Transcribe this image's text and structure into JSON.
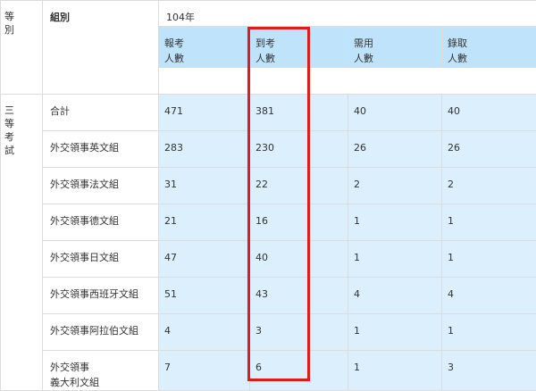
{
  "header": {
    "exam_class": "等別",
    "group": "組別",
    "year": "104年",
    "columns": [
      {
        "line1": "報考",
        "line2": "人數"
      },
      {
        "line1": "到考",
        "line2": "人數"
      },
      {
        "line1": "需用",
        "line2": "人數"
      },
      {
        "line1": "錄取",
        "line2": "人數"
      }
    ]
  },
  "exam_level": "三等考試",
  "rows": [
    {
      "name": [
        "合計"
      ],
      "values": [
        "471",
        "381",
        "40",
        "40"
      ]
    },
    {
      "name": [
        "外交領事英文組"
      ],
      "values": [
        "283",
        "230",
        "26",
        "26"
      ]
    },
    {
      "name": [
        "外交領事法文組"
      ],
      "values": [
        "31",
        "22",
        "2",
        "2"
      ]
    },
    {
      "name": [
        "外交領事德文組"
      ],
      "values": [
        "21",
        "16",
        "1",
        "1"
      ]
    },
    {
      "name": [
        "外交領事日文組"
      ],
      "values": [
        "47",
        "40",
        "1",
        "1"
      ]
    },
    {
      "name": [
        "外交領事西班牙文組"
      ],
      "values": [
        "51",
        "43",
        "4",
        "4"
      ]
    },
    {
      "name": [
        "外交領事阿拉伯文組"
      ],
      "values": [
        "4",
        "3",
        "1",
        "1"
      ]
    },
    {
      "name": [
        "外交領事",
        "義大利文組"
      ],
      "values": [
        "7",
        "6",
        "1",
        "3"
      ]
    }
  ],
  "highlight": {
    "color": "#e01b1b",
    "column": "到考人數"
  },
  "colors": {
    "header_bg": "#bfe3fb",
    "cell_bg": "#dbeffd",
    "border": "#dcdcdc"
  }
}
